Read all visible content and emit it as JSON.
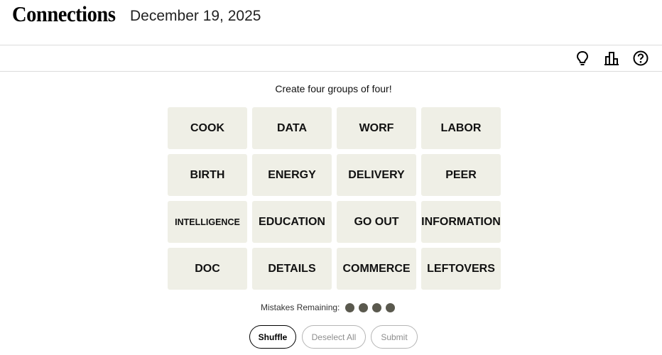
{
  "header": {
    "title": "Connections",
    "date": "December 19, 2025"
  },
  "toolbar": {
    "icons": [
      "lightbulb-icon",
      "bar-chart-icon",
      "help-icon"
    ]
  },
  "prompt": "Create four groups of four!",
  "tiles": [
    "COOK",
    "DATA",
    "WORF",
    "LABOR",
    "BIRTH",
    "ENERGY",
    "DELIVERY",
    "PEER",
    "INTELLIGENCE",
    "EDUCATION",
    "GO OUT",
    "INFORMATION",
    "DOC",
    "DETAILS",
    "COMMERCE",
    "LEFTOVERS"
  ],
  "mistakes": {
    "label": "Mistakes Remaining:",
    "remaining": 4
  },
  "buttons": {
    "shuffle": "Shuffle",
    "deselect": "Deselect All",
    "submit": "Submit"
  },
  "colors": {
    "tile_bg": "#efefe6",
    "dot": "#5a594e"
  }
}
